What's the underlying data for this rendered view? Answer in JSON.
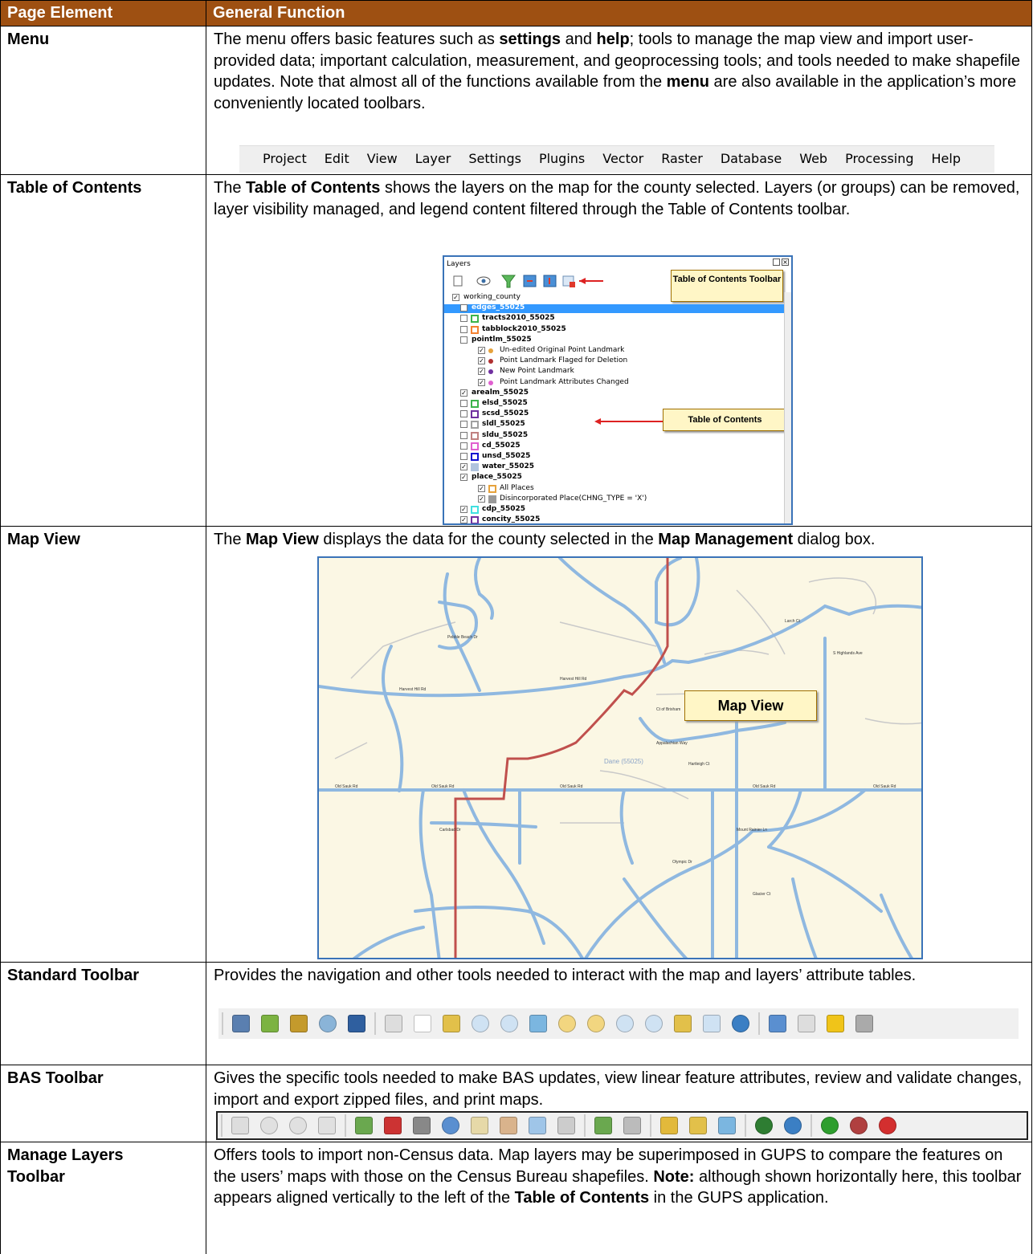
{
  "header": {
    "col1": "Page Element",
    "col2": "General Function"
  },
  "rows": {
    "menu": {
      "label": "Menu",
      "t1": "The menu offers basic features such as ",
      "b1": "settings",
      "t2": " and ",
      "b2": "help",
      "t3": "; tools to manage the map view and import user-provided data; important calculation, measurement, and geoprocessing tools; and tools needed to make shapefile updates. Note that almost all of the functions available from the ",
      "b3": "menu",
      "t4": " are also available in the application’s more conveniently located toolbars."
    },
    "toc": {
      "label": "Table of Contents",
      "t1": "The ",
      "b1": "Table of Contents",
      "t2": " shows the layers on the map for the county selected. Layers (or groups) can be removed, layer visibility managed, and legend content filtered through the Table of Contents toolbar."
    },
    "mapview": {
      "label": "Map View",
      "t1": "The ",
      "b1": "Map View",
      "t2": " displays the data for the county selected in the ",
      "b2": "Map Management",
      "t3": " dialog box."
    },
    "standard": {
      "label": "Standard Toolbar",
      "t1": "Provides the navigation and other tools needed to interact with the map and layers’ attribute tables."
    },
    "bas": {
      "label": "BAS Toolbar",
      "t1": "Gives the specific tools needed to make BAS updates, view linear feature attributes, review and validate changes, import and export zipped files, and print maps."
    },
    "manage": {
      "label1": "Manage Layers",
      "label2": "Toolbar",
      "t1": "Offers tools to import non-Census data. Map layers may be superimposed in GUPS to compare the features on the users’ maps with those on the Census Bureau shapefiles. ",
      "b1": "Note:",
      "t2": " although shown horizontally here, this toolbar appears aligned vertically to the left of the ",
      "b2": "Table of Contents",
      "t3": " in the GUPS application."
    }
  },
  "menubar": [
    "Project",
    "Edit",
    "View",
    "Layer",
    "Settings",
    "Plugins",
    "Vector",
    "Raster",
    "Database",
    "Web",
    "Processing",
    "Help"
  ],
  "layers_panel": {
    "title": "Layers",
    "callout_toolbar": "Table of Contents Toolbar",
    "callout_toc": "Table of Contents",
    "items": [
      {
        "name": "working_county",
        "bold": false
      },
      {
        "name": "edges_55025",
        "bold": true
      },
      {
        "name": "tracts2010_55025",
        "bold": true
      },
      {
        "name": "tabblock2010_55025",
        "bold": true
      },
      {
        "name": "pointlm_55025",
        "bold": true
      },
      {
        "name": "Un-edited Original Point Landmark",
        "bold": false
      },
      {
        "name": "Point Landmark Flaged for Deletion",
        "bold": false
      },
      {
        "name": "New Point Landmark",
        "bold": false
      },
      {
        "name": "Point Landmark Attributes Changed",
        "bold": false
      },
      {
        "name": "arealm_55025",
        "bold": true
      },
      {
        "name": "elsd_55025",
        "bold": true
      },
      {
        "name": "scsd_55025",
        "bold": true
      },
      {
        "name": "sldl_55025",
        "bold": true
      },
      {
        "name": "sldu_55025",
        "bold": true
      },
      {
        "name": "cd_55025",
        "bold": true
      },
      {
        "name": "unsd_55025",
        "bold": true
      },
      {
        "name": "water_55025",
        "bold": true
      },
      {
        "name": "place_55025",
        "bold": true
      },
      {
        "name": "All Places",
        "bold": false
      },
      {
        "name": "Disincorporated Place(CHNG_TYPE = 'X')",
        "bold": false
      },
      {
        "name": "cdp_55025",
        "bold": true
      },
      {
        "name": "concity_55025",
        "bold": true
      }
    ]
  },
  "map": {
    "callout": "Map View",
    "county": "Dane (55025)",
    "streets": [
      "Old Sauk Rd",
      "Harvest Hill Rd",
      "Pebble Beach Dr",
      "Appalachian Way",
      "Mount Rainier Ln",
      "Olympic Dr",
      "Carlsbad Dr",
      "Glacier Ct",
      "Ct of Brixham",
      "S Highlands Ave",
      "Larch Ct",
      "Hartleigh Ct"
    ]
  },
  "colors": {
    "header_bg": "#9e5012",
    "map_bg": "#fbf7e4",
    "road": "#8fb8e0",
    "boundary": "#c0504d",
    "frame": "#3a73b8"
  }
}
